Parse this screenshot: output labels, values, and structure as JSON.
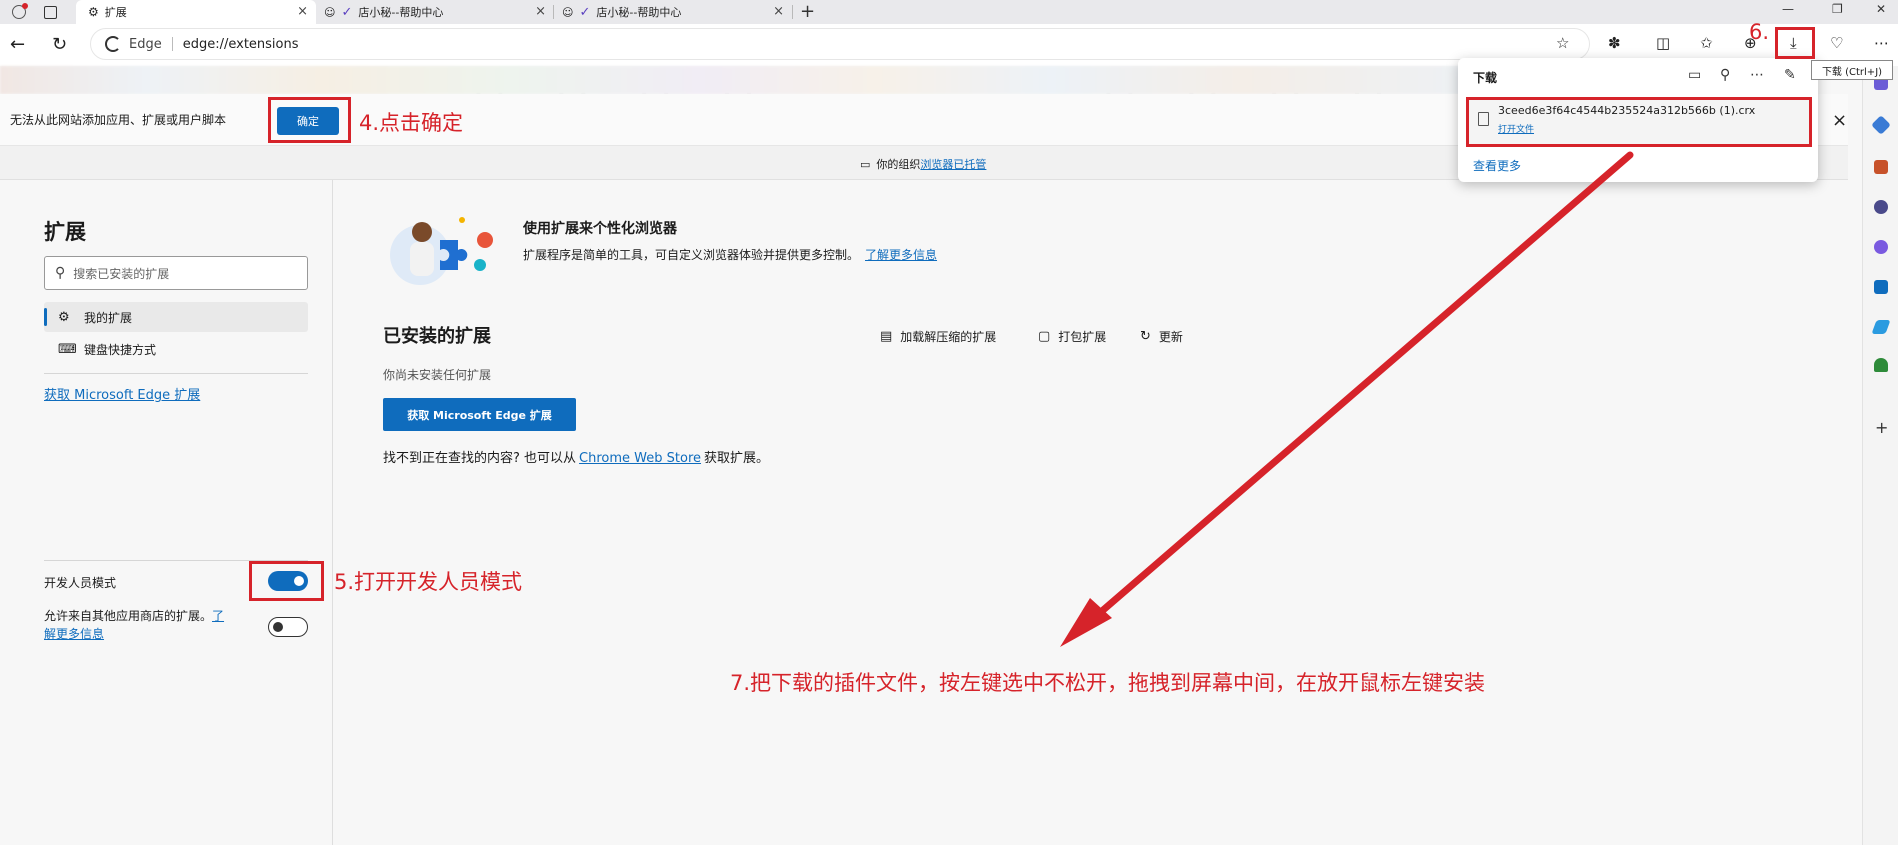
{
  "tabs": [
    {
      "label": "扩展",
      "close": "×"
    },
    {
      "label": "店小秘--帮助中心",
      "close": "×"
    },
    {
      "label": "店小秘--帮助中心",
      "close": "×"
    }
  ],
  "new_tab": "+",
  "address": {
    "site": "Edge",
    "url": "edge://extensions"
  },
  "notice": {
    "text": "无法从此网站添加应用、扩展或用户脚本",
    "ok": "确定",
    "close": "×"
  },
  "managed": {
    "prefix": "你的组织",
    "link": "浏览器已托管"
  },
  "sidebar": {
    "title": "扩展",
    "search_placeholder": "搜索已安装的扩展",
    "items": [
      {
        "label": "我的扩展"
      },
      {
        "label": "键盘快捷方式"
      }
    ],
    "get_link": "获取 Microsoft Edge 扩展",
    "dev_mode": "开发人员模式",
    "allow_other": "允许来自其他应用商店的扩展。",
    "allow_link_1": "了",
    "allow_link_2": "解更多信息"
  },
  "hero": {
    "title": "使用扩展来个性化浏览器",
    "desc": "扩展程序是简单的工具，可自定义浏览器体验并提供更多控制。",
    "link": "了解更多信息"
  },
  "installed": {
    "title": "已安装的扩展",
    "actions": [
      "加载解压缩的扩展",
      "打包扩展",
      "更新"
    ],
    "none": "你尚未安装任何扩展",
    "get_button": "获取 Microsoft Edge 扩展",
    "cant_find_pre": "找不到正在查找的内容? 也可以从",
    "cant_find_link": "Chrome Web Store",
    "cant_find_post": "获取扩展。"
  },
  "downloads": {
    "title": "下载",
    "file": "3ceed6e3f64c4544b235524a312b566b (1).crx",
    "open": "打开文件",
    "more": "查看更多",
    "tooltip": "下载 (Ctrl+J)"
  },
  "annotations": {
    "step4": "4.点击确定",
    "step5": "5.打开开发人员模式",
    "step6": "6.",
    "step7": "7.把下载的插件文件，按左键选中不松开，拖拽到屏幕中间，在放开鼠标左键安装"
  },
  "colors": {
    "accent": "#0f6cbd",
    "annotation": "#d6232a"
  }
}
